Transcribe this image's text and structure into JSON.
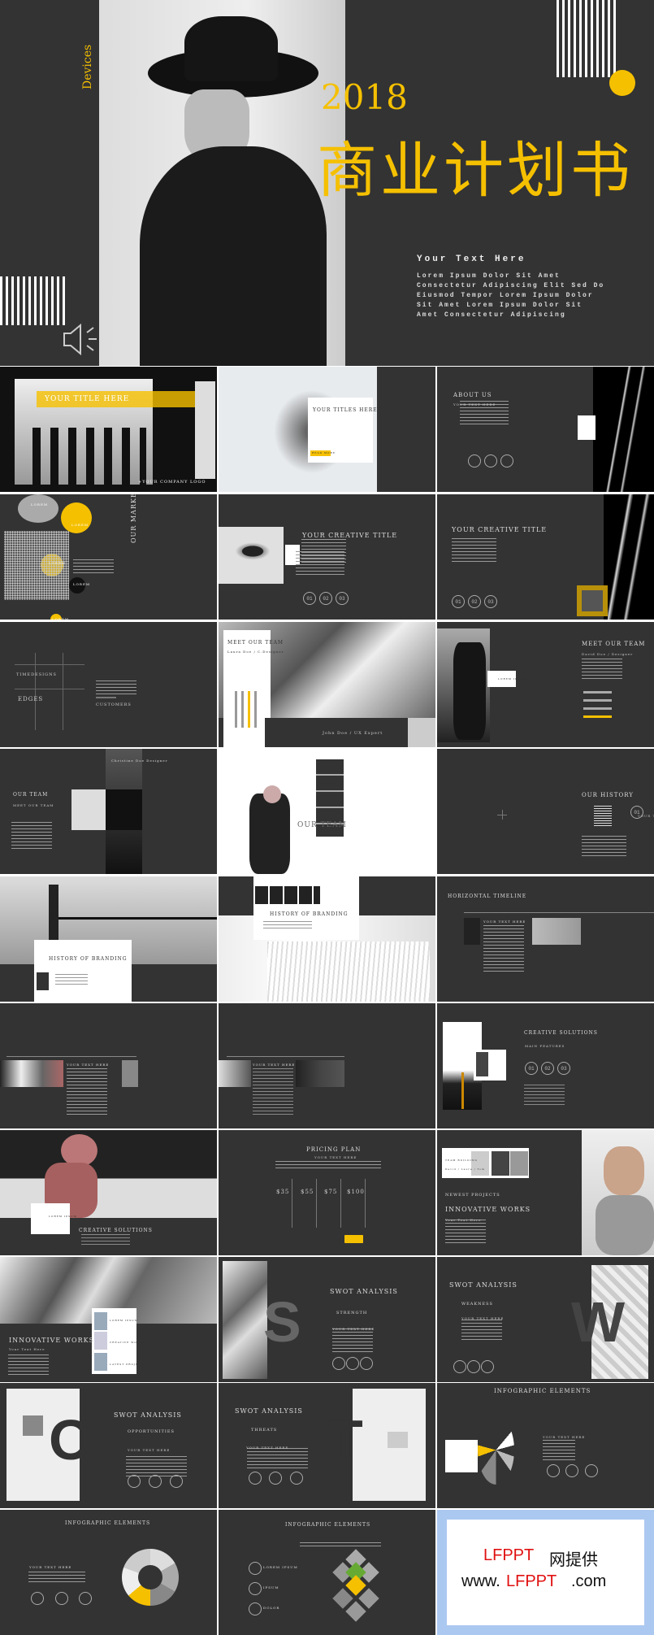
{
  "hero": {
    "vertical_label": "Devices",
    "year": "2018",
    "title": "商业计划书",
    "subtitle": "Your Text Here",
    "body_lines": [
      "Lorem Ipsum Dolor Sit Amet",
      "Consectetur Adipiscing Elit Sed Do",
      "Eiusmod Tempor Lorem Ipsum Dolor",
      "Sit Amet Lorem Ipsum Dolor Sit",
      "Amet Consectetur Adipiscing"
    ],
    "speaker_icon": "speaker-icon"
  },
  "colors": {
    "accent": "#f5c000",
    "dark": "#333333",
    "light": "#e6e6e6"
  },
  "slides": [
    {
      "texts": [
        "YOUR TITLE HERE",
        "+YOUR COMPANY LOGO"
      ]
    },
    {
      "texts": [
        "YOUR TITLES HERE",
        "READ MORE"
      ]
    },
    {
      "texts": [
        "ABOUT US",
        "YOUR TEXT HERE"
      ]
    },
    {
      "texts": [
        "OUR MARKET",
        "LOREM",
        "LOREM",
        "LOREM",
        "LOREM",
        "LOREM"
      ]
    },
    {
      "texts": [
        "YOUR CREATIVE TITLE",
        "01",
        "02",
        "03"
      ]
    },
    {
      "texts": [
        "YOUR CREATIVE TITLE",
        "01",
        "02",
        "03"
      ]
    },
    {
      "texts": [
        "TIMEDESIGNS",
        "EDGES",
        "CUSTOMERS"
      ]
    },
    {
      "texts": [
        "MEET OUR TEAM",
        "Laura Doe / C.Designer",
        "John Doe / UX Expert"
      ]
    },
    {
      "texts": [
        "MEET OUR TEAM",
        "David Doe / Designer",
        "LOREM IPSUM"
      ]
    },
    {
      "texts": [
        "OUR TEAM",
        "MEET OUR TEAM",
        "Christine Doe Designer"
      ]
    },
    {
      "texts": [
        "OUR TEAM"
      ]
    },
    {
      "texts": [
        "OUR HISTORY",
        "01",
        "YOUR TEXT HERE"
      ]
    },
    {
      "texts": [
        "HISTORY OF BRANDING"
      ]
    },
    {
      "texts": [
        "HISTORY OF BRANDING"
      ]
    },
    {
      "texts": [
        "HORIZONTAL TIMELINE",
        "YOUR TEXT HERE"
      ]
    },
    {
      "texts": [
        "YOUR TEXT HERE"
      ]
    },
    {
      "texts": [
        "YOUR TEXT HERE"
      ]
    },
    {
      "texts": [
        "CREATIVE SOLUTIONS",
        "MAIN FEATURES",
        "01",
        "02",
        "03"
      ]
    },
    {
      "texts": [
        "CREATIVE SOLUTIONS",
        "LOREM IPSUM"
      ]
    },
    {
      "texts": [
        "PRICING PLAN",
        "YOUR TEXT HERE",
        "$35",
        "$55",
        "$75",
        "$100"
      ]
    },
    {
      "texts": [
        "NEWEST PROJECTS",
        "INNOVATIVE WORKS",
        "Your Text Here",
        "TEAM BUILDING",
        "David / Laura / Tom"
      ]
    },
    {
      "texts": [
        "INNOVATIVE WORKS",
        "Your Text Here",
        "LOREM IPSUM",
        "CREATIVE WORKS",
        "LATEST PROJECTS"
      ]
    },
    {
      "texts": [
        "SWOT ANALYSIS",
        "STRENGTH",
        "YOUR TEXT HERE",
        "S"
      ]
    },
    {
      "texts": [
        "SWOT ANALYSIS",
        "WEAKNESS",
        "YOUR TEXT HERE",
        "W"
      ]
    },
    {
      "texts": [
        "SWOT ANALYSIS",
        "OPPORTUNITIES",
        "YOUR TEXT HERE",
        "O"
      ]
    },
    {
      "texts": [
        "SWOT ANALYSIS",
        "THREATS",
        "YOUR TEXT HERE",
        "T"
      ]
    },
    {
      "texts": [
        "INFOGRAPHIC ELEMENTS",
        "YOUR TEXT HERE"
      ]
    },
    {
      "texts": [
        "INFOGRAPHIC ELEMENTS",
        "YOUR TEXT HERE"
      ]
    },
    {
      "texts": [
        "INFOGRAPHIC ELEMENTS",
        "LOREM IPSUM",
        "IPSUM",
        "DOLOR"
      ]
    },
    {
      "texts": [
        "LFPPT",
        "网提供",
        "www.",
        "LFPPT",
        ".com"
      ]
    }
  ]
}
